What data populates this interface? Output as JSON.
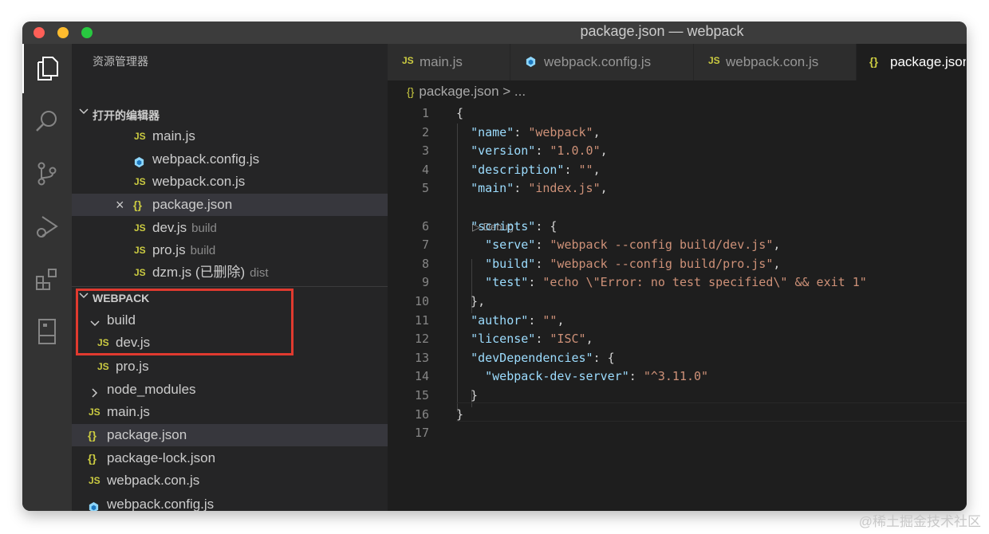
{
  "window": {
    "title": "package.json — webpack"
  },
  "colors": {
    "highlight_box": "#e03a2f",
    "js_icon": "#cbcb41",
    "json_key": "#9cdcfe",
    "json_string": "#ce9178"
  },
  "activity_bar": [
    {
      "icon": "files-icon",
      "active": true
    },
    {
      "icon": "search-icon"
    },
    {
      "icon": "source-control-icon"
    },
    {
      "icon": "run-debug-icon"
    },
    {
      "icon": "extensions-icon"
    },
    {
      "icon": "remote-explorer-icon"
    }
  ],
  "sidebar": {
    "title": "资源管理器",
    "open_editors": {
      "label": "打开的编辑器",
      "items": [
        {
          "icon": "JS",
          "name": "main.js",
          "desc": ""
        },
        {
          "icon": "webpack",
          "name": "webpack.config.js",
          "desc": ""
        },
        {
          "icon": "JS",
          "name": "webpack.con.js",
          "desc": ""
        },
        {
          "icon": "{}",
          "name": "package.json",
          "desc": "",
          "selected": true,
          "close": "×"
        },
        {
          "icon": "JS",
          "name": "dev.js",
          "desc": "build"
        },
        {
          "icon": "JS",
          "name": "pro.js",
          "desc": "build"
        },
        {
          "icon": "JS",
          "name": "dzm.js (已删除)",
          "desc": "dist"
        }
      ]
    },
    "workspace": {
      "label": "WEBPACK",
      "items": [
        {
          "type": "folder",
          "name": "build",
          "expanded": true
        },
        {
          "icon": "JS",
          "name": "dev.js"
        },
        {
          "icon": "JS",
          "name": "pro.js"
        },
        {
          "type": "folder",
          "name": "node_modules",
          "expanded": false
        },
        {
          "icon": "JS",
          "name": "main.js"
        },
        {
          "icon": "{}",
          "name": "package.json",
          "selected": true
        },
        {
          "icon": "{}",
          "name": "package-lock.json"
        },
        {
          "icon": "JS",
          "name": "webpack.con.js"
        },
        {
          "icon": "webpack",
          "name": "webpack.config.js"
        }
      ]
    }
  },
  "tabs": [
    {
      "icon": "JS",
      "label": "main.js"
    },
    {
      "icon": "webpack",
      "label": "webpack.config.js"
    },
    {
      "icon": "JS",
      "label": "webpack.con.js"
    },
    {
      "icon": "{}",
      "label": "package.json",
      "active": true
    }
  ],
  "editor": {
    "breadcrumb": {
      "file": "package.json",
      "rest": "> ..."
    },
    "codelens": "▷ Debug",
    "line_numbers": [
      "1",
      "2",
      "3",
      "4",
      "5",
      "6",
      "7",
      "8",
      "9",
      "10",
      "11",
      "12",
      "13",
      "14",
      "15",
      "16",
      "17"
    ],
    "lines": [
      "{",
      "  \"name\": \"webpack\",",
      "  \"version\": \"1.0.0\",",
      "  \"description\": \"\",",
      "  \"main\": \"index.js\",",
      "  \"scripts\": {",
      "    \"serve\": \"webpack --config build/dev.js\",",
      "    \"build\": \"webpack --config build/pro.js\",",
      "    \"test\": \"echo \\\"Error: no test specified\\\" && exit 1\"",
      "  },",
      "  \"author\": \"\",",
      "  \"license\": \"ISC\",",
      "  \"devDependencies\": {",
      "    \"webpack-dev-server\": \"^3.11.0\"",
      "  }",
      "}",
      ""
    ]
  },
  "watermark": "@稀土掘金技术社区"
}
